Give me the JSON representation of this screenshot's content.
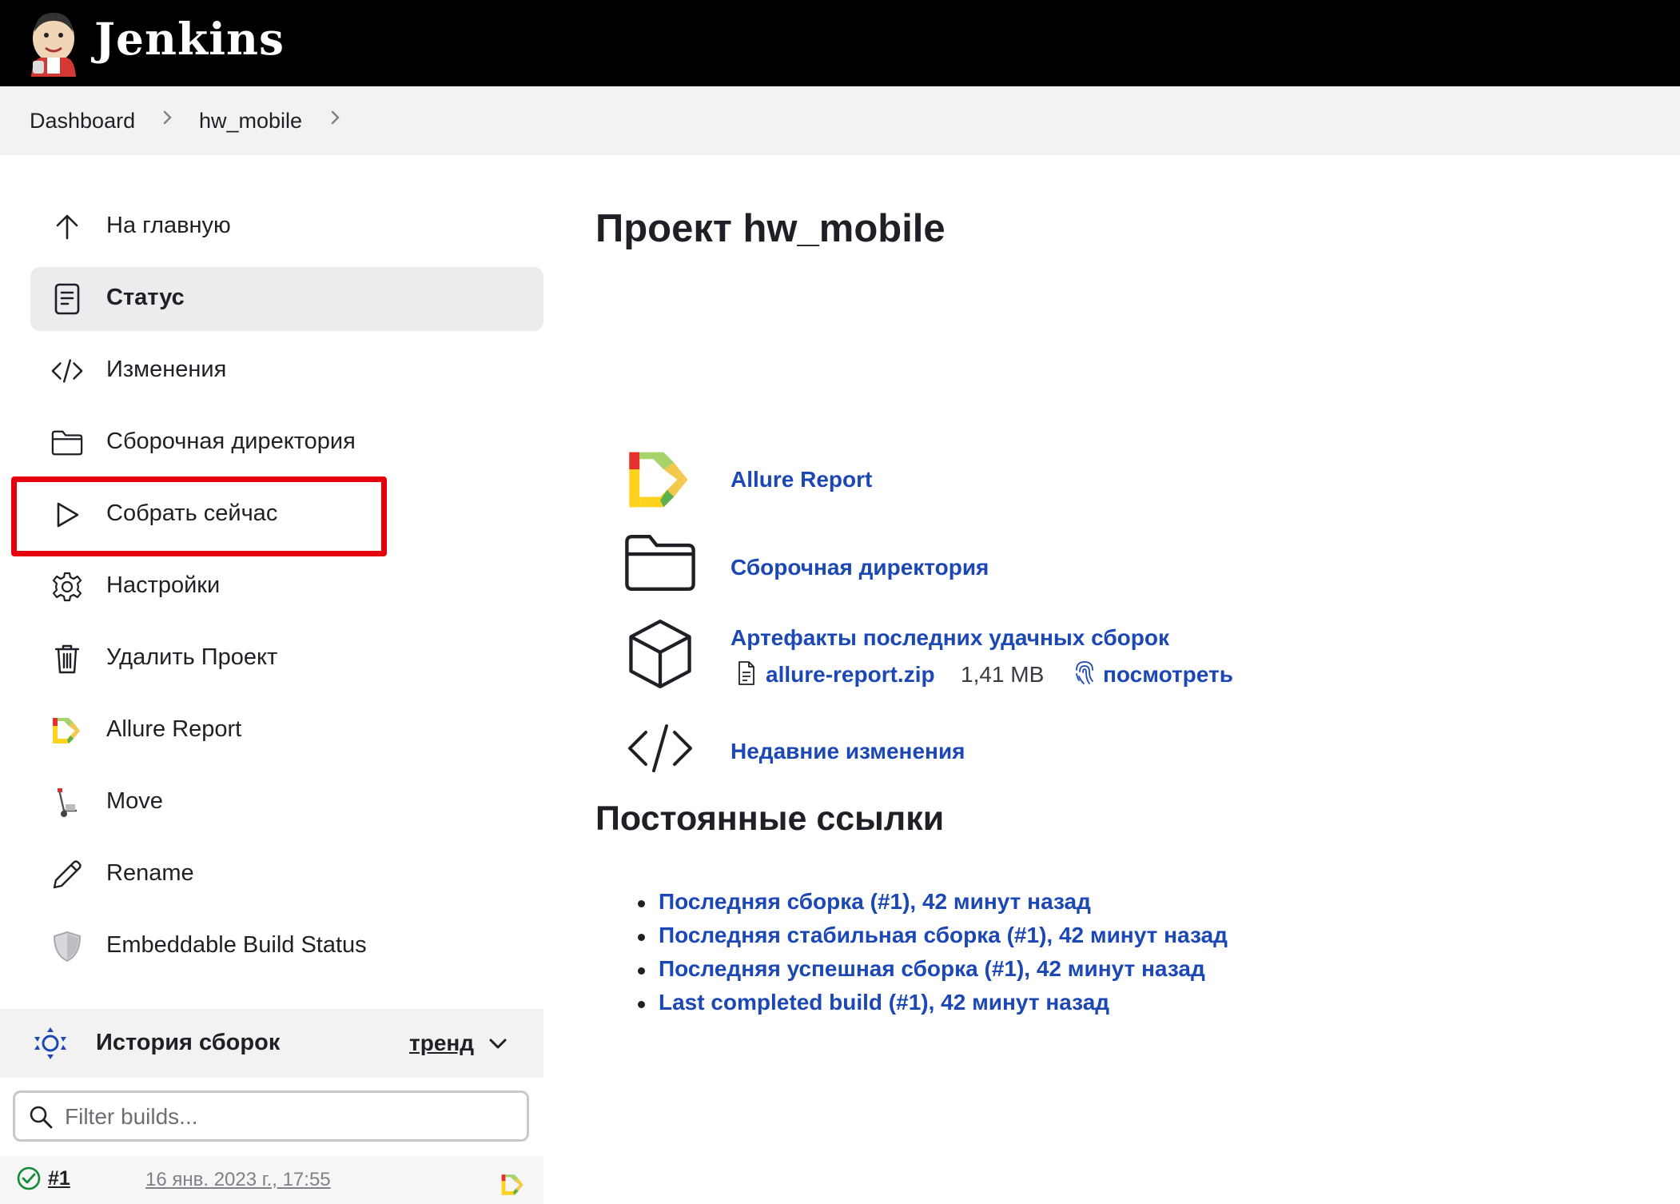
{
  "header": {
    "app_name": "Jenkins"
  },
  "breadcrumb": {
    "items": [
      "Dashboard",
      "hw_mobile"
    ]
  },
  "sidebar": {
    "items": [
      {
        "label": "На главную",
        "icon": "arrow-up-icon"
      },
      {
        "label": "Статус",
        "icon": "document-icon",
        "active": true
      },
      {
        "label": "Изменения",
        "icon": "code-icon"
      },
      {
        "label": "Сборочная директория",
        "icon": "folder-icon"
      },
      {
        "label": "Собрать сейчас",
        "icon": "play-icon",
        "highlighted": true
      },
      {
        "label": "Настройки",
        "icon": "gear-icon"
      },
      {
        "label": "Удалить Проект",
        "icon": "trash-icon"
      },
      {
        "label": "Allure Report",
        "icon": "allure-icon"
      },
      {
        "label": "Move",
        "icon": "move-icon"
      },
      {
        "label": "Rename",
        "icon": "pencil-icon"
      },
      {
        "label": "Embeddable Build Status",
        "icon": "shield-icon"
      }
    ]
  },
  "build_history": {
    "title": "История сборок",
    "trend_label": "тренд",
    "filter_placeholder": "Filter builds...",
    "builds": [
      {
        "number": "#1",
        "date": "16 янв. 2023 г., 17:55",
        "status": "success"
      }
    ]
  },
  "main": {
    "title": "Проект hw_mobile",
    "links": {
      "allure": "Allure Report",
      "workspace": "Сборочная директория",
      "artifacts": "Артефакты последних удачных сборок",
      "changes": "Недавние изменения"
    },
    "artifact": {
      "file": "allure-report.zip",
      "size": "1,41 MB",
      "view_label": "посмотреть"
    },
    "permalinks_title": "Постоянные ссылки",
    "permalinks": [
      "Последняя сборка (#1), 42 минут назад",
      "Последняя стабильная сборка (#1), 42 минут назад",
      "Последняя успешная сборка (#1), 42 минут назад",
      "Last completed build (#1), 42 минут назад"
    ]
  },
  "colors": {
    "header_bg": "#000000",
    "link": "#1c48b5",
    "highlight": "#e4000d",
    "active_item_bg": "#ececee",
    "success": "#138a36"
  }
}
